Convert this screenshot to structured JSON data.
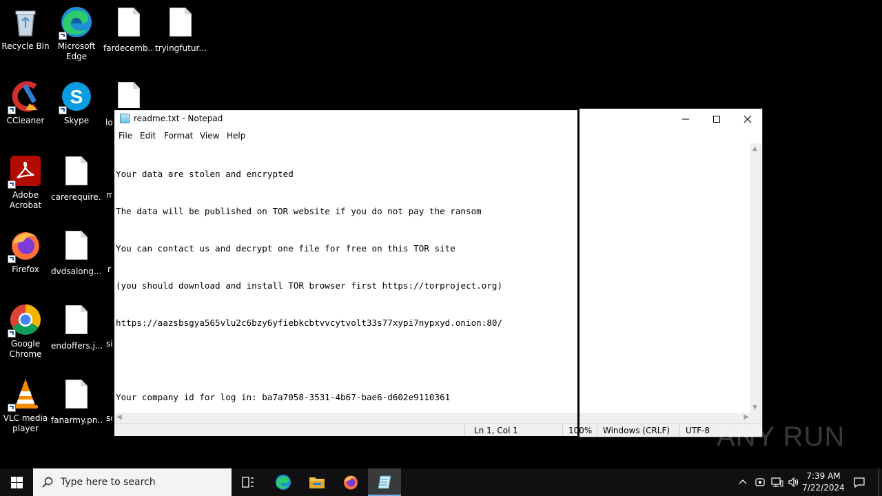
{
  "desktop": {
    "icons": [
      {
        "label": "Recycle Bin"
      },
      {
        "label": "Microsoft Edge"
      },
      {
        "label": "fardecemb..."
      },
      {
        "label": "tryingfutur..."
      },
      {
        "label": "CCleaner"
      },
      {
        "label": "Skype"
      },
      {
        "label": "lo"
      },
      {
        "label": "Adobe Acrobat"
      },
      {
        "label": "carerequire..."
      },
      {
        "label": "m"
      },
      {
        "label": "Firefox"
      },
      {
        "label": "dvdsalong...."
      },
      {
        "label": "r"
      },
      {
        "label": "Google Chrome"
      },
      {
        "label": "endoffers.j..."
      },
      {
        "label": "si"
      },
      {
        "label": "VLC media player"
      },
      {
        "label": "fanarmy.pn..."
      },
      {
        "label": "sc"
      }
    ]
  },
  "notepad": {
    "title": "readme.txt - Notepad",
    "menu": [
      "File",
      "Edit",
      "Format",
      "View",
      "Help"
    ],
    "lines": [
      "Your data are stolen and encrypted",
      "The data will be published on TOR website if you do not pay the ransom",
      "You can contact us and decrypt one file for free on this TOR site",
      "(you should download and install TOR browser first https://torproject.org)",
      "https://aazsbsgya565vlu2c6bzy6yfiebkcbtvvcytvolt33s77xypi7nypxyd.onion:80/",
      "",
      "Your company id for log in: ba7a7058-3531-4b67-bae6-d602e9110361"
    ],
    "status": {
      "position": "Ln 1, Col 1",
      "zoom": "100%",
      "line_ending": "Windows (CRLF)",
      "encoding": "UTF-8"
    }
  },
  "watermark": "ANY RUN",
  "taskbar": {
    "search_placeholder": "Type here to search",
    "time": "7:39 AM",
    "date": "7/22/2024"
  }
}
